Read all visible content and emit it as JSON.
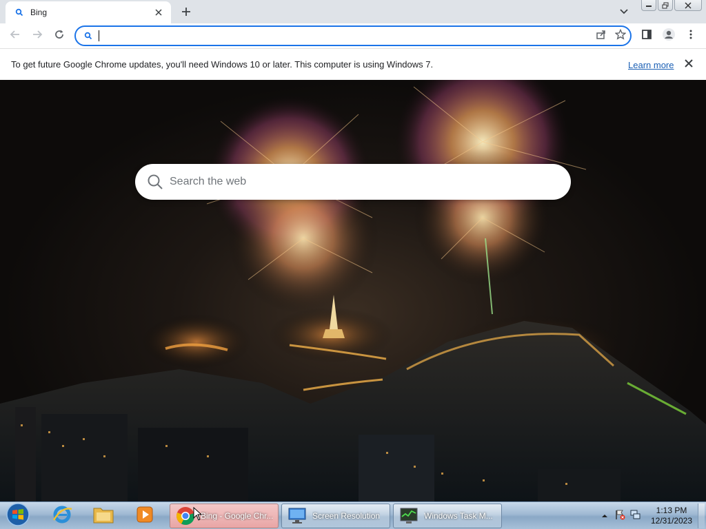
{
  "browser": {
    "tab": {
      "title": "Bing",
      "favicon": "search-icon"
    },
    "window_buttons": [
      "minimize",
      "restore",
      "close"
    ]
  },
  "toolbar": {
    "omnibox": {
      "value": "",
      "placeholder": ""
    }
  },
  "infobar": {
    "message": "To get future Google Chrome updates, you'll need Windows 10 or later. This computer is using Windows 7.",
    "link": "Learn more"
  },
  "page": {
    "search_placeholder": "Search the web"
  },
  "taskbar": {
    "tasks": [
      {
        "label": "Bing - Google Chr...",
        "icon": "chrome-icon"
      },
      {
        "label": "Screen Resolution",
        "icon": "monitor-icon"
      },
      {
        "label": "Windows Task M...",
        "icon": "task-manager-icon"
      }
    ],
    "clock": {
      "time": "1:13 PM",
      "date": "12/31/2023"
    }
  },
  "colors": {
    "accent": "#1a73e8",
    "tabstrip": "#dfe3e8",
    "link": "#1a5fb4"
  }
}
